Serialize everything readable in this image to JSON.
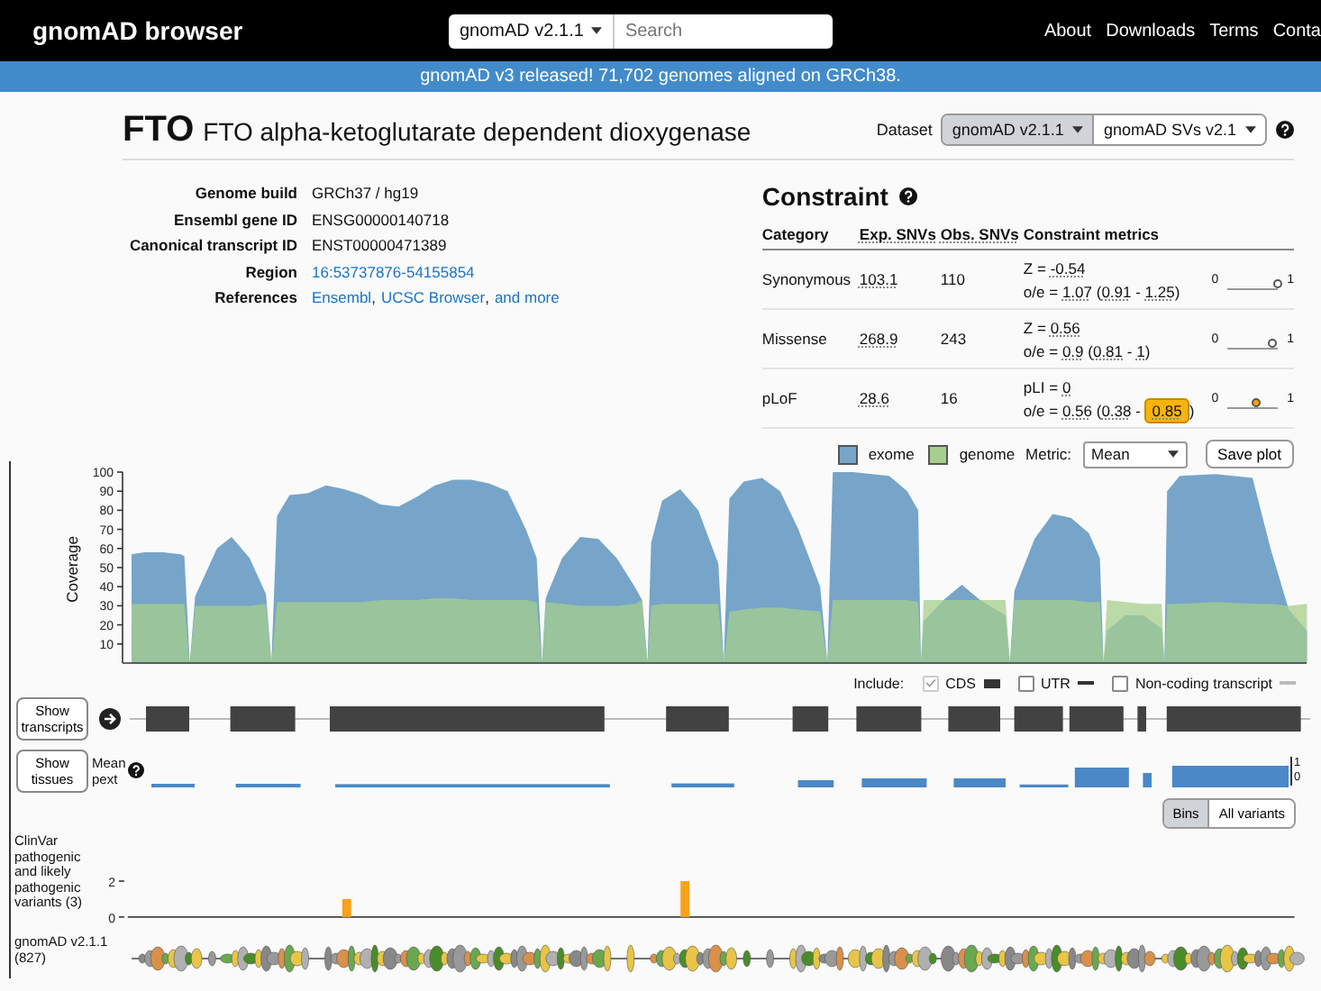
{
  "header": {
    "logo": "gnomAD browser",
    "dataset_select": "gnomAD v2.1.1",
    "search": {
      "placeholder": "Search"
    },
    "nav": [
      "About",
      "Downloads",
      "Terms",
      "Conta"
    ]
  },
  "banner": "gnomAD v3 released! 71,702 genomes aligned on GRCh38.",
  "gene": {
    "symbol": "FTO",
    "name": "FTO alpha-ketoglutarate dependent dioxygenase"
  },
  "dataset": {
    "label": "Dataset",
    "options": [
      {
        "label": "gnomAD v2.1.1",
        "selected": true
      },
      {
        "label": "gnomAD SVs v2.1",
        "selected": false
      }
    ]
  },
  "info": [
    {
      "label": "Genome build",
      "parts": [
        {
          "kind": "plain",
          "text": "GRCh37 / hg19"
        }
      ]
    },
    {
      "label": "Ensembl gene ID",
      "parts": [
        {
          "kind": "plain",
          "text": "ENSG00000140718"
        }
      ]
    },
    {
      "label": "Canonical transcript ID",
      "parts": [
        {
          "kind": "plain",
          "text": "ENST00000471389"
        }
      ]
    },
    {
      "label": "Region",
      "parts": [
        {
          "kind": "link",
          "text": "16:53737876-54155854"
        }
      ]
    },
    {
      "label": "References",
      "parts": [
        {
          "kind": "link",
          "text": "Ensembl"
        },
        {
          "kind": "plain",
          "text": ","
        },
        {
          "kind": "link",
          "text": "UCSC Browser"
        },
        {
          "kind": "plain",
          "text": ","
        },
        {
          "kind": "link",
          "text": "and more"
        }
      ]
    }
  ],
  "constraint": {
    "title": "Constraint",
    "columns": [
      {
        "label": "Category",
        "dotted": false
      },
      {
        "label": "Exp. SNVs",
        "dotted": true
      },
      {
        "label": "Obs. SNVs",
        "dotted": true
      },
      {
        "label": "Constraint metrics",
        "dotted": false
      }
    ],
    "rows": [
      {
        "category": "Synonymous",
        "exp": "103.1",
        "obs": "110",
        "line1": [
          {
            "kind": "plain",
            "text": "Z = "
          },
          {
            "kind": "value",
            "text": "-0.54"
          }
        ],
        "line2": [
          {
            "kind": "plain",
            "text": "o/e = "
          },
          {
            "kind": "value",
            "text": "1.07"
          },
          {
            "kind": "plain",
            "text": " ("
          },
          {
            "kind": "value",
            "text": "0.91"
          },
          {
            "kind": "plain",
            "text": " - "
          },
          {
            "kind": "value",
            "text": "1.25"
          },
          {
            "kind": "plain",
            "text": ")"
          }
        ],
        "level": 1,
        "min": "0",
        "max": "1"
      },
      {
        "category": "Missense",
        "exp": "268.9",
        "obs": "243",
        "line1": [
          {
            "kind": "plain",
            "text": "Z = "
          },
          {
            "kind": "value",
            "text": "0.56"
          }
        ],
        "line2": [
          {
            "kind": "plain",
            "text": "o/e = "
          },
          {
            "kind": "value",
            "text": "0.9"
          },
          {
            "kind": "plain",
            "text": " ("
          },
          {
            "kind": "value",
            "text": "0.81"
          },
          {
            "kind": "plain",
            "text": " - "
          },
          {
            "kind": "value",
            "text": "1"
          },
          {
            "kind": "plain",
            "text": ")"
          }
        ],
        "level": 0.9,
        "min": "0",
        "max": "1"
      },
      {
        "category": "pLoF",
        "exp": "28.6",
        "obs": "16",
        "line1": [
          {
            "kind": "plain",
            "text": "pLI = "
          },
          {
            "kind": "value",
            "text": "0"
          }
        ],
        "line2": [
          {
            "kind": "plain",
            "text": "o/e = "
          },
          {
            "kind": "value",
            "text": "0.56"
          },
          {
            "kind": "plain",
            "text": " ("
          },
          {
            "kind": "value",
            "text": "0.38"
          },
          {
            "kind": "plain",
            "text": " - "
          },
          {
            "kind": "flagged",
            "text": "0.85"
          },
          {
            "kind": "plain",
            "text": ")"
          }
        ],
        "level": 0.56,
        "min": "0",
        "max": "1"
      }
    ]
  },
  "coverage": {
    "legend": [
      {
        "name": "exome",
        "color": "#76a5c9"
      },
      {
        "name": "genome",
        "color": "#a5cf8c"
      }
    ],
    "metric_label": "Metric:",
    "metric": "Mean",
    "save_button": "Save plot",
    "ylabel": "Coverage",
    "yticks": [
      "100",
      "90",
      "80",
      "70",
      "60",
      "50",
      "40",
      "30",
      "20",
      "10"
    ]
  },
  "include": {
    "label": "Include:",
    "options": [
      {
        "label": "CDS",
        "checked": true,
        "kind": "block"
      },
      {
        "label": "UTR",
        "checked": false,
        "kind": "line"
      },
      {
        "label": "Non-coding transcript",
        "checked": false,
        "kind": "faint"
      }
    ]
  },
  "transcripts_button": "Show transcripts",
  "tissues_button": "Show tissues",
  "pext": {
    "label": "Mean pext",
    "ticks": [
      "1",
      "0"
    ]
  },
  "variant_view": [
    {
      "label": "Bins",
      "selected": true
    },
    {
      "label": "All variants",
      "selected": false
    }
  ],
  "clinvar": {
    "label": "ClinVar pathogenic and likely pathogenic variants (3)",
    "yticks": [
      "2",
      "0"
    ]
  },
  "gnomad_track": {
    "label": "gnomAD v2.1.1",
    "count": "(827)"
  }
}
